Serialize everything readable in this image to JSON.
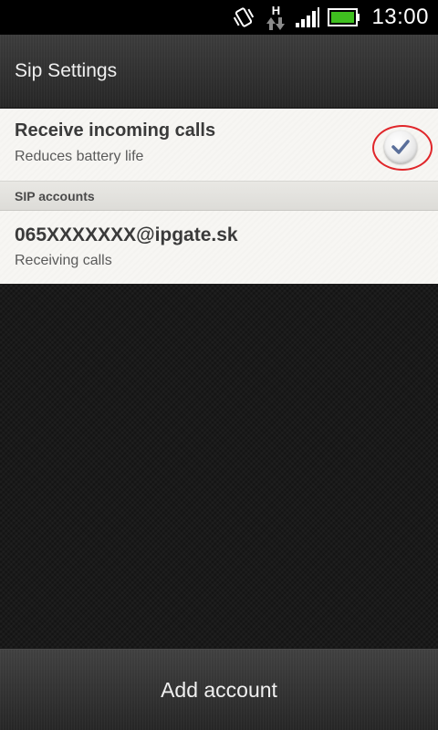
{
  "status_bar": {
    "icons": [
      "vibrate-icon",
      "hsdpa-data-icon",
      "signal-strength-icon",
      "battery-icon"
    ],
    "network_label": "H",
    "clock": "13:00",
    "battery_color": "#3fbf1f"
  },
  "title_bar": {
    "title": "Sip Settings"
  },
  "settings": {
    "receive_calls": {
      "title": "Receive incoming calls",
      "subtitle": "Reduces battery life",
      "checked": true,
      "check_color": "#5a6f9a",
      "highlight_color": "#e0262a"
    },
    "section_header": "SIP accounts",
    "account": {
      "title": "065XXXXXXX@ipgate.sk",
      "subtitle": "Receiving calls"
    }
  },
  "bottom_bar": {
    "add_account_label": "Add account"
  }
}
